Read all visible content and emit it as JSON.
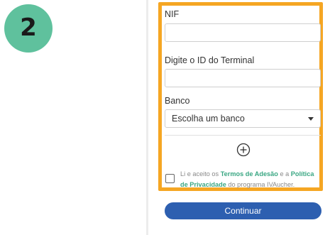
{
  "step": {
    "number": "2"
  },
  "form": {
    "nif": {
      "label": "NIF",
      "value": ""
    },
    "terminal": {
      "label": "Digite o ID do Terminal",
      "value": ""
    },
    "bank": {
      "label": "Banco",
      "selected": "Escolha um banco"
    },
    "add_icon": "plus-circle-icon",
    "terms": {
      "prefix": "Li e aceito os ",
      "link1": "Termos de Adesão",
      "middle": " e a ",
      "link2": "Política de Privacidade",
      "suffix": " do programa IVAucher.",
      "checked": false
    },
    "continue_label": "Continuar"
  },
  "colors": {
    "highlight_border": "#f5a623",
    "step_badge": "#5fc19d",
    "link": "#3aa783",
    "button": "#2d5fb0"
  }
}
